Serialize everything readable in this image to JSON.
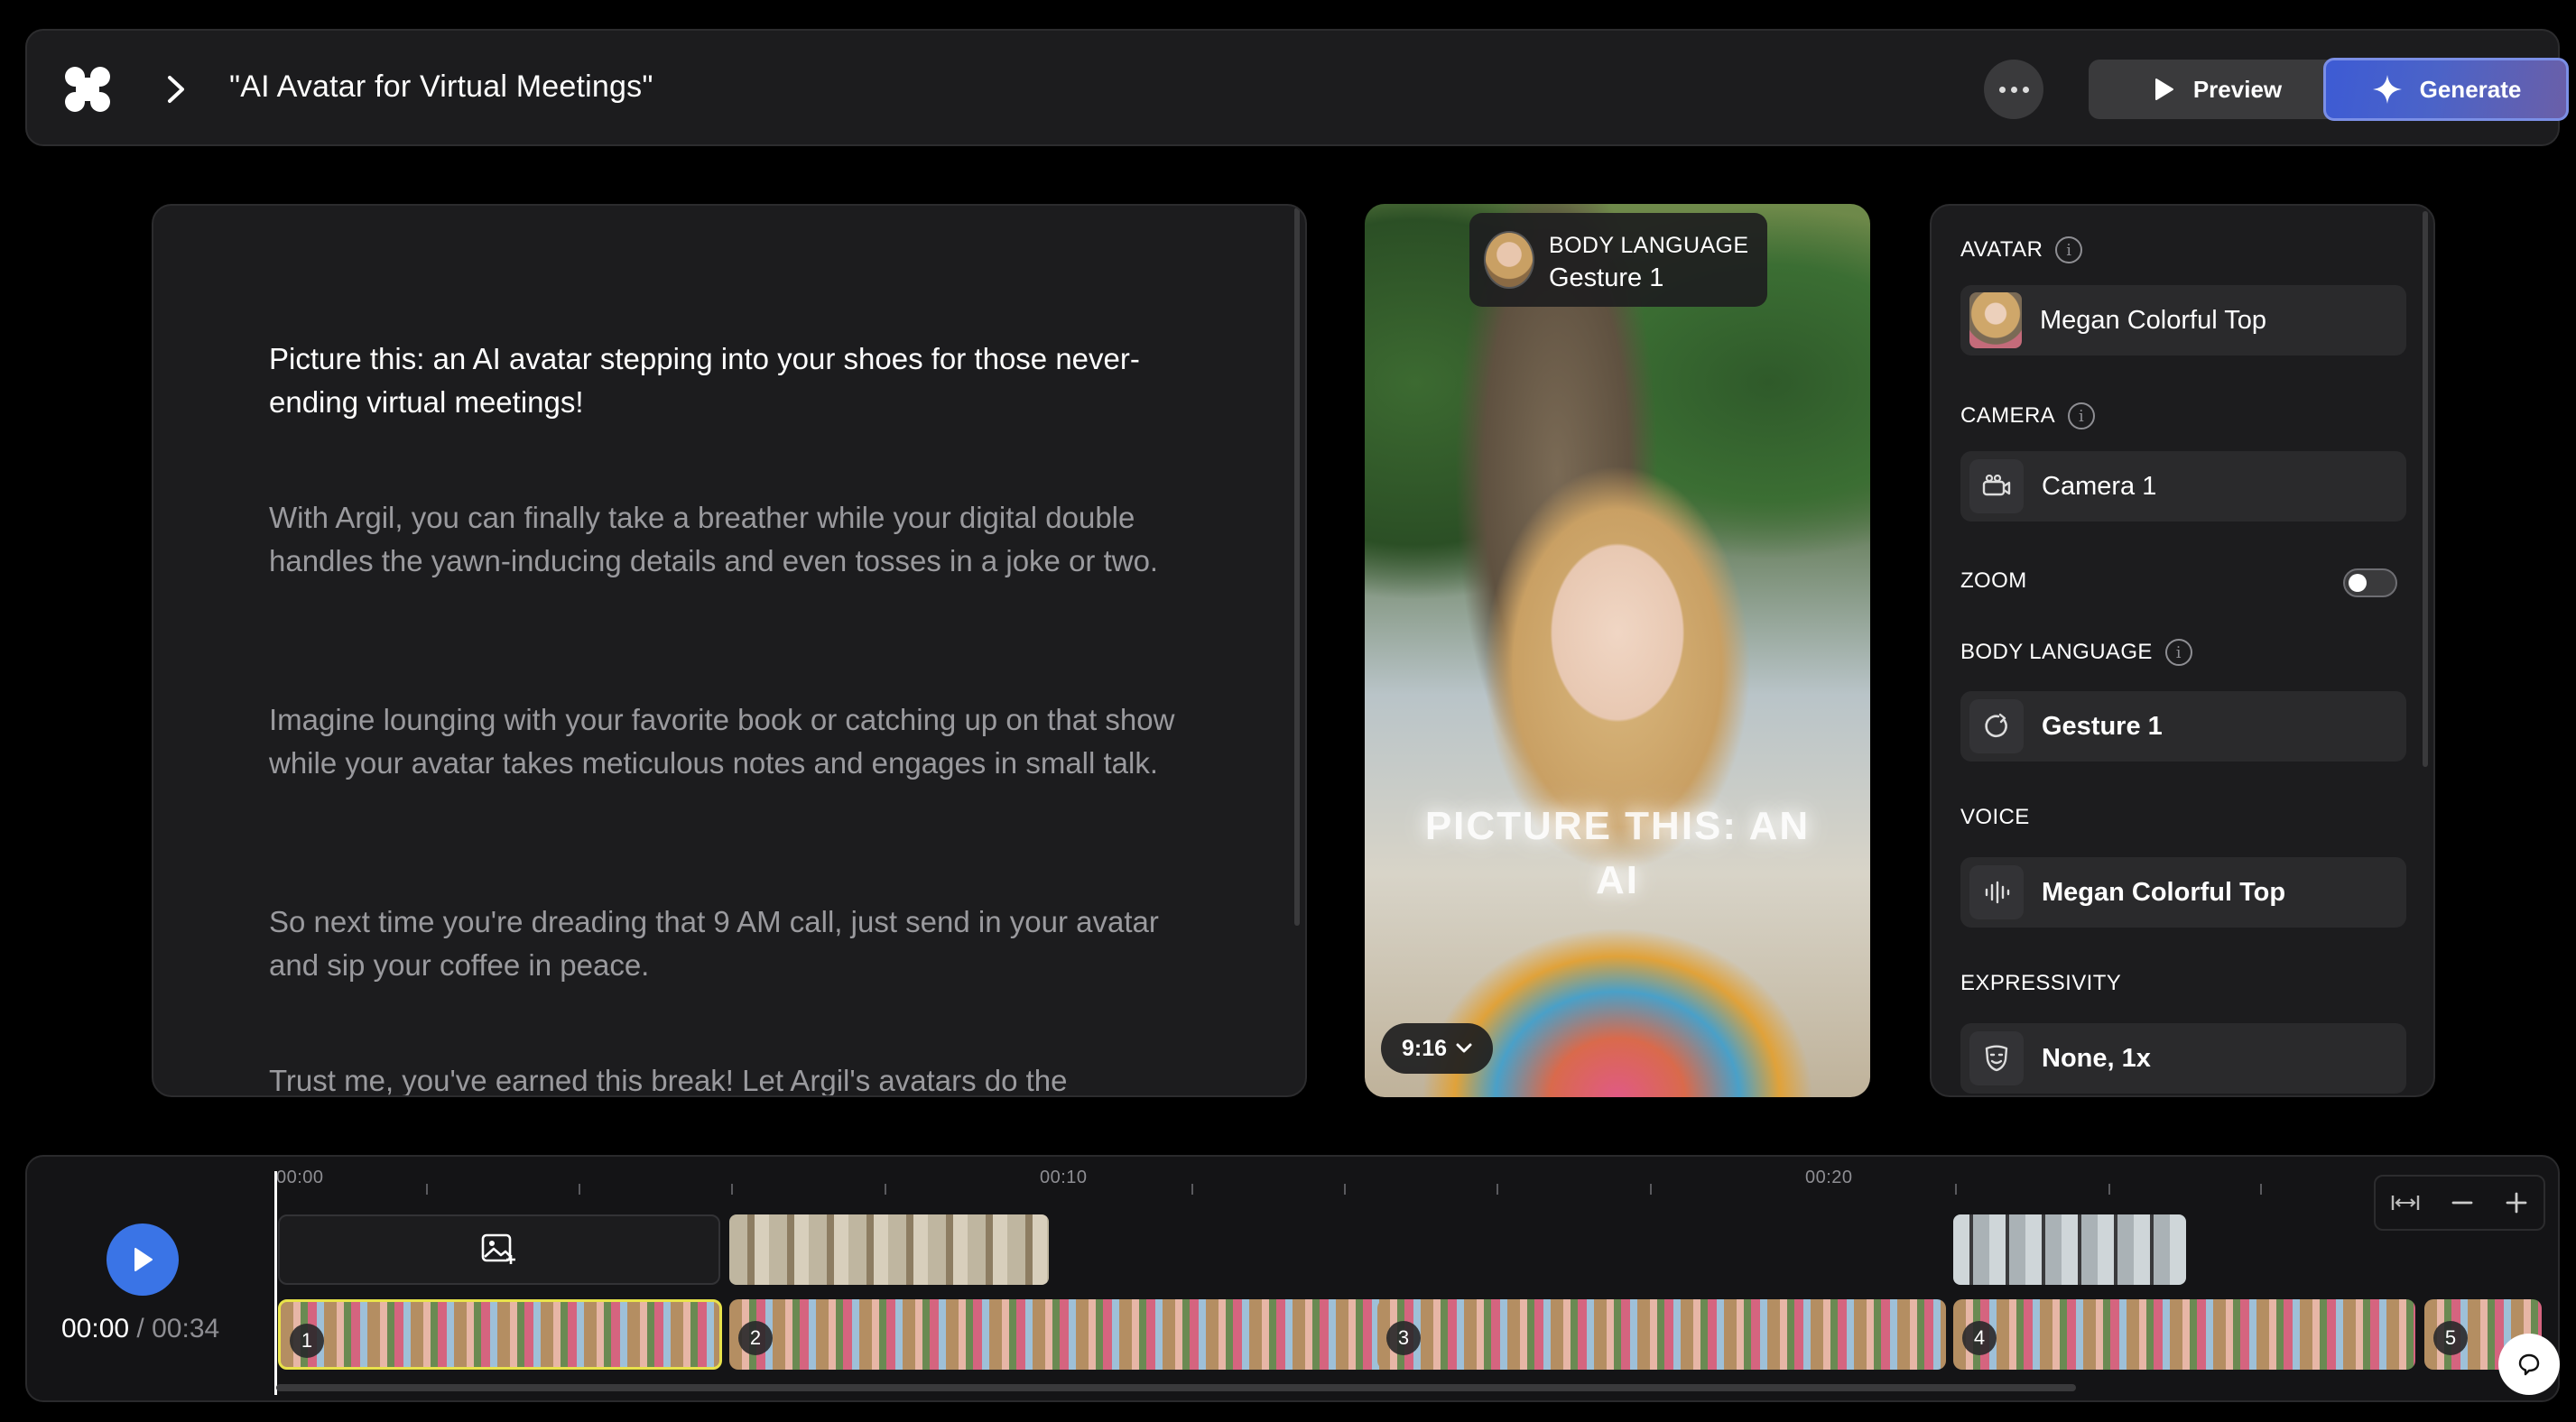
{
  "header": {
    "project_title": "\"AI Avatar for Virtual Meetings\"",
    "preview_label": "Preview",
    "generate_label": "Generate"
  },
  "script": {
    "paragraphs": [
      "Picture this: an AI avatar stepping into your shoes for those never-ending virtual meetings!",
      "With Argil, you can finally take a breather while your digital double handles the yawn-inducing details and even tosses in a joke or two.",
      "Imagine lounging with your favorite book or catching up on that show while your avatar takes meticulous notes and engages in small talk.",
      "So next time you're dreading that 9 AM call, just send in your avatar and sip your coffee in peace.",
      "Trust me, you've earned this break! Let Argil's avatars do the"
    ]
  },
  "video": {
    "badge_key": "BODY LANGUAGE",
    "badge_value": "Gesture 1",
    "caption": "PICTURE THIS: AN AI",
    "aspect_ratio": "9:16"
  },
  "settings": {
    "avatar_label": "AVATAR",
    "avatar_value": "Megan Colorful Top",
    "camera_label": "CAMERA",
    "camera_value": "Camera 1",
    "zoom_label": "ZOOM",
    "zoom_on": false,
    "body_label": "BODY LANGUAGE",
    "body_value": "Gesture 1",
    "voice_label": "VOICE",
    "voice_value": "Megan Colorful Top",
    "expressivity_label": "EXPRESSIVITY",
    "expressivity_value": "None, 1x"
  },
  "timeline": {
    "current_time": "00:00",
    "separator": "/",
    "total_time": "00:34",
    "ruler": [
      "00:00",
      "00:10",
      "00:20"
    ],
    "clips": [
      "1",
      "2",
      "3",
      "4",
      "5"
    ]
  },
  "colors": {
    "accent_blue": "#3a74e6",
    "selected_clip": "#e8e24a",
    "panel_bg": "#1c1c1e"
  }
}
